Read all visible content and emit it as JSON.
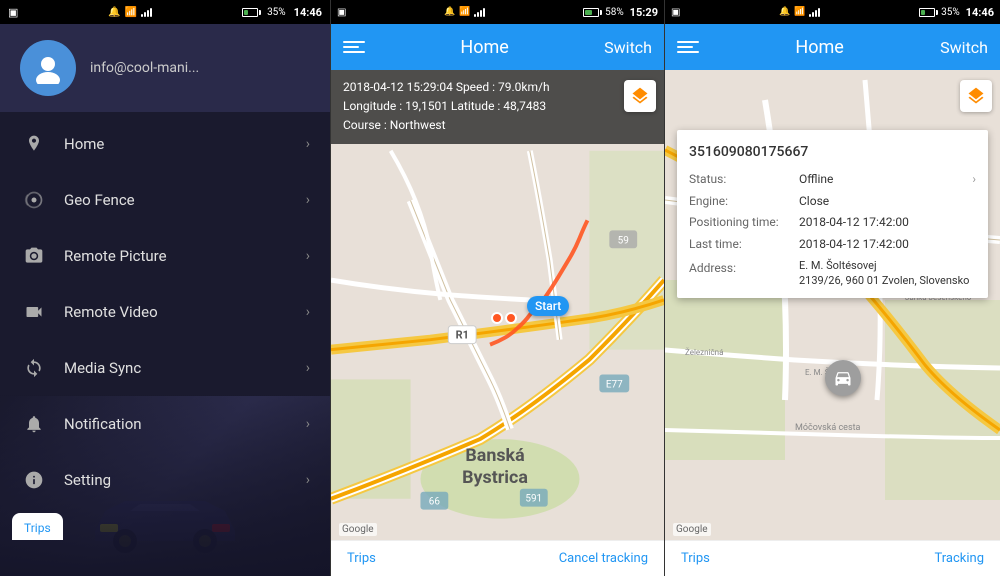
{
  "panel1": {
    "status": {
      "left": "▣",
      "center_icons": [
        "alarm",
        "wifi",
        "signal"
      ],
      "battery": "35%",
      "time": "14:46"
    },
    "profile": {
      "email": "info@cool-mani...",
      "avatar_icon": "👤"
    },
    "nav_items": [
      {
        "id": "home",
        "label": "Home",
        "icon": "📍"
      },
      {
        "id": "geo-fence",
        "label": "Geo Fence",
        "icon": "⚙"
      },
      {
        "id": "remote-picture",
        "label": "Remote Picture",
        "icon": "📷"
      },
      {
        "id": "remote-video",
        "label": "Remote Video",
        "icon": "🎥"
      },
      {
        "id": "media-sync",
        "label": "Media Sync",
        "icon": "↻"
      },
      {
        "id": "notification",
        "label": "Notification",
        "icon": "🔔"
      },
      {
        "id": "setting",
        "label": "Setting",
        "icon": "ℹ"
      }
    ],
    "trips_label": "Trips"
  },
  "panel2": {
    "status": {
      "left": "▣",
      "battery": "58%",
      "time": "15:29"
    },
    "header": {
      "title": "Home",
      "switch_label": "Switch"
    },
    "trip_info": {
      "line1": "2018-04-12 15:29:04  Speed : 79.0km/h",
      "line2": "Longitude : 19,1501  Latitude : 48,7483",
      "line3": "Course : Northwest"
    },
    "bottom": {
      "trips": "Trips",
      "cancel": "Cancel tracking"
    },
    "map": {
      "city": "Banská\nBystrica",
      "start_label": "Start",
      "google_label": "Google"
    }
  },
  "panel3": {
    "status": {
      "left": "▣",
      "battery": "35%",
      "time": "14:46"
    },
    "header": {
      "title": "Home",
      "switch_label": "Switch"
    },
    "device": {
      "id": "351609080175667",
      "status_label": "Status:",
      "status_value": "Offline",
      "engine_label": "Engine:",
      "engine_value": "Close",
      "positioning_label": "Positioning time:",
      "positioning_value": "2018-04-12 17:42:00",
      "last_label": "Last time:",
      "last_value": "2018-04-12 17:42:00",
      "address_label": "Address:",
      "address_value": "E. M. Šoltésovej\n2139/26, 960 01 Zvolen, Slovensko"
    },
    "bottom": {
      "trips": "Trips",
      "tracking": "Tracking"
    },
    "map": {
      "google_label": "Google"
    }
  }
}
